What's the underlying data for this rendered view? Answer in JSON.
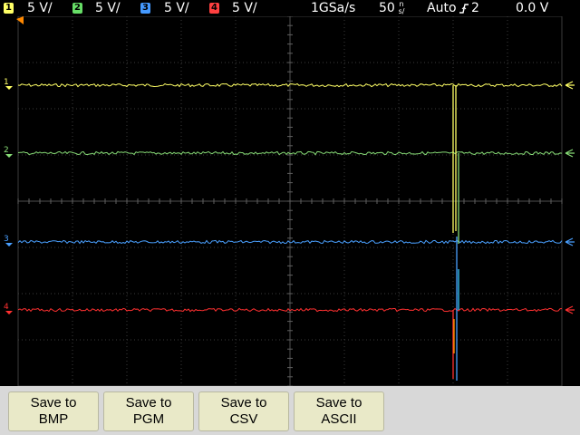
{
  "header": {
    "channels": [
      {
        "number": "1",
        "scale": "5 V/",
        "color": "#ffff66"
      },
      {
        "number": "2",
        "scale": "5 V/",
        "color": "#66dd66"
      },
      {
        "number": "3",
        "scale": "5 V/",
        "color": "#4499ff"
      },
      {
        "number": "4",
        "scale": "5 V/",
        "color": "#ff4040"
      }
    ],
    "sample_rate": "1GSa/s",
    "timebase": "50",
    "timebase_unit_top": "n",
    "timebase_unit_bottom": "s/",
    "trigger_mode": "Auto",
    "trigger_icon": "rising-edge-trigger-icon",
    "trigger_source": "2",
    "trigger_level": "0.0 V"
  },
  "traces": [
    {
      "channel": "1",
      "color": "#ffff66",
      "label": "1",
      "level_position": "upper"
    },
    {
      "channel": "2",
      "color": "#88dd77",
      "label": "2",
      "level_position": "upper-middle"
    },
    {
      "channel": "3",
      "color": "#4aa0ff",
      "label": "3",
      "level_position": "lower-middle"
    },
    {
      "channel": "4",
      "color": "#ff3030",
      "label": "4",
      "level_position": "lower"
    }
  ],
  "softkeys": [
    {
      "line1": "Save to",
      "line2": "BMP"
    },
    {
      "line1": "Save to",
      "line2": "PGM"
    },
    {
      "line1": "Save to",
      "line2": "CSV"
    },
    {
      "line1": "Save to",
      "line2": "ASCII"
    }
  ]
}
